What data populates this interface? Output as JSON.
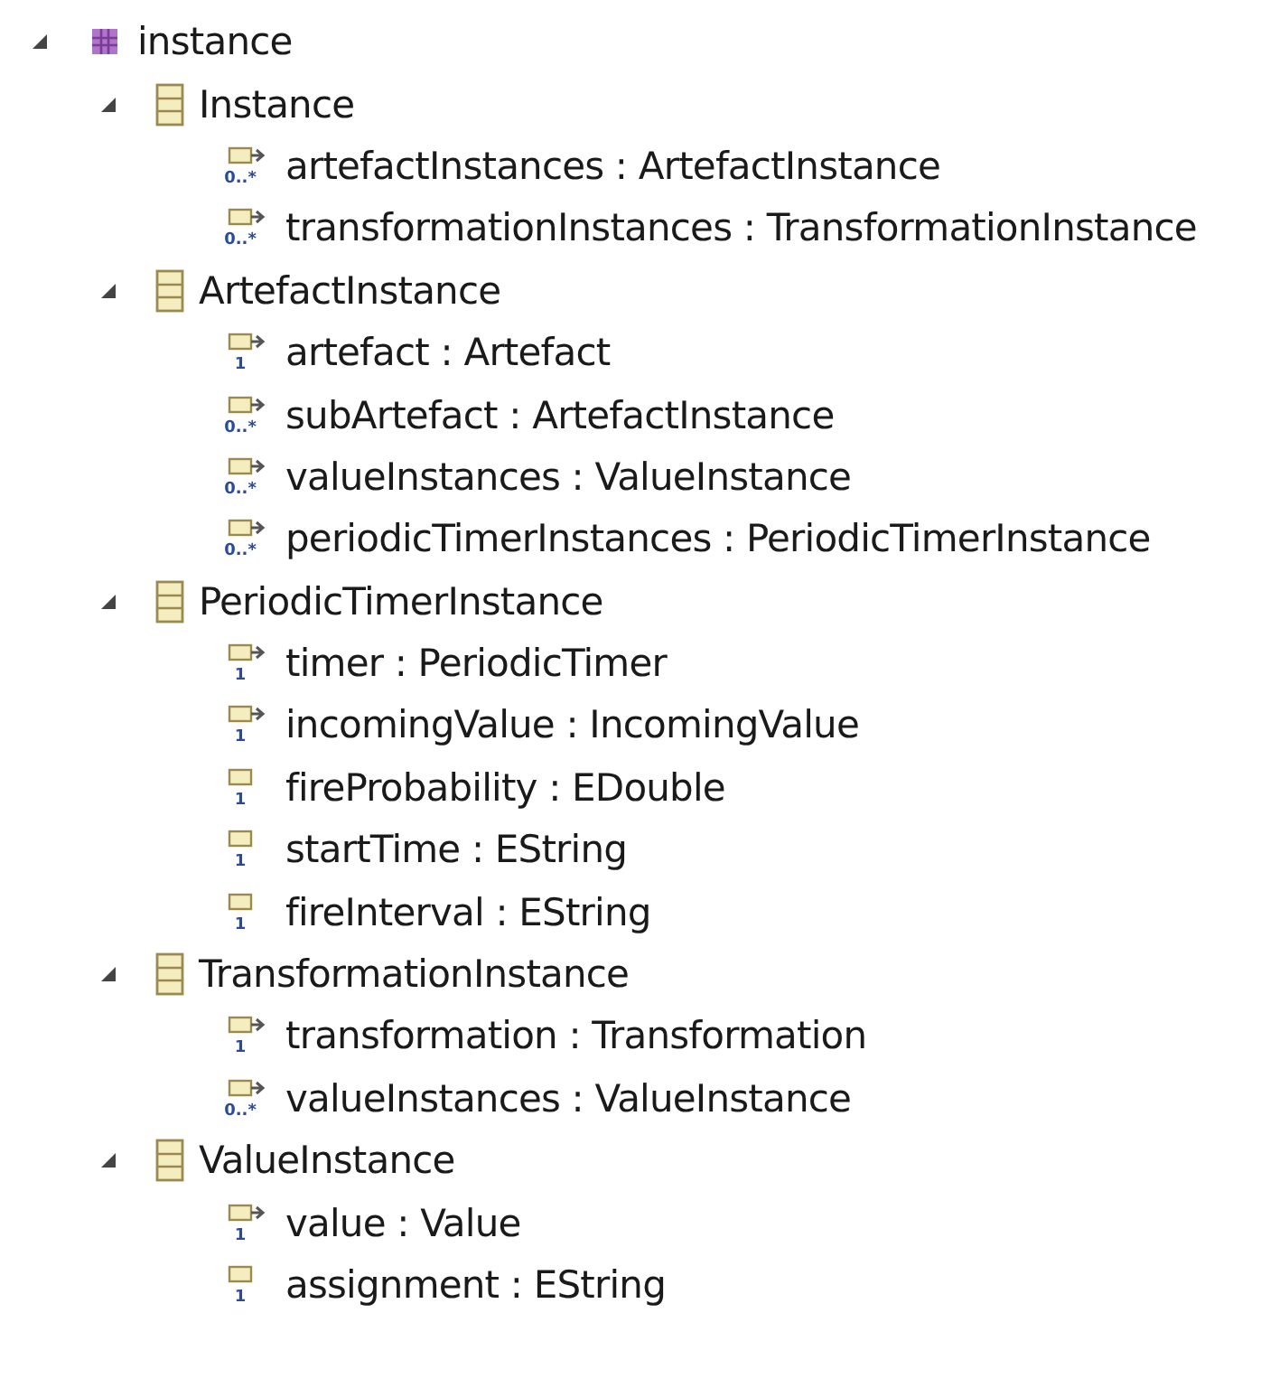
{
  "tree": [
    {
      "label": "instance",
      "kind": "package",
      "expanded": true,
      "children": [
        {
          "label": "Instance",
          "kind": "class",
          "expanded": true,
          "children": [
            {
              "label": "artefactInstances : ArtefactInstance",
              "kind": "reference",
              "multiplicity": "0..*"
            },
            {
              "label": "transformationInstances : TransformationInstance",
              "kind": "reference",
              "multiplicity": "0..*"
            }
          ]
        },
        {
          "label": "ArtefactInstance",
          "kind": "class",
          "expanded": true,
          "children": [
            {
              "label": "artefact : Artefact",
              "kind": "reference",
              "multiplicity": "1"
            },
            {
              "label": "subArtefact : ArtefactInstance",
              "kind": "reference",
              "multiplicity": "0..*"
            },
            {
              "label": "valueInstances : ValueInstance",
              "kind": "reference",
              "multiplicity": "0..*"
            },
            {
              "label": "periodicTimerInstances : PeriodicTimerInstance",
              "kind": "reference",
              "multiplicity": "0..*"
            }
          ]
        },
        {
          "label": "PeriodicTimerInstance",
          "kind": "class",
          "expanded": true,
          "children": [
            {
              "label": "timer : PeriodicTimer",
              "kind": "reference",
              "multiplicity": "1"
            },
            {
              "label": "incomingValue : IncomingValue",
              "kind": "reference",
              "multiplicity": "1"
            },
            {
              "label": "fireProbability : EDouble",
              "kind": "attribute",
              "multiplicity": "1"
            },
            {
              "label": "startTime : EString",
              "kind": "attribute",
              "multiplicity": "1"
            },
            {
              "label": "fireInterval : EString",
              "kind": "attribute",
              "multiplicity": "1"
            }
          ]
        },
        {
          "label": "TransformationInstance",
          "kind": "class",
          "expanded": true,
          "children": [
            {
              "label": "transformation : Transformation",
              "kind": "reference",
              "multiplicity": "1"
            },
            {
              "label": "valueInstances : ValueInstance",
              "kind": "reference",
              "multiplicity": "0..*"
            }
          ]
        },
        {
          "label": "ValueInstance",
          "kind": "class",
          "expanded": true,
          "children": [
            {
              "label": "value : Value",
              "kind": "reference",
              "multiplicity": "1"
            },
            {
              "label": "assignment : EString",
              "kind": "attribute",
              "multiplicity": "1"
            }
          ]
        }
      ]
    }
  ]
}
